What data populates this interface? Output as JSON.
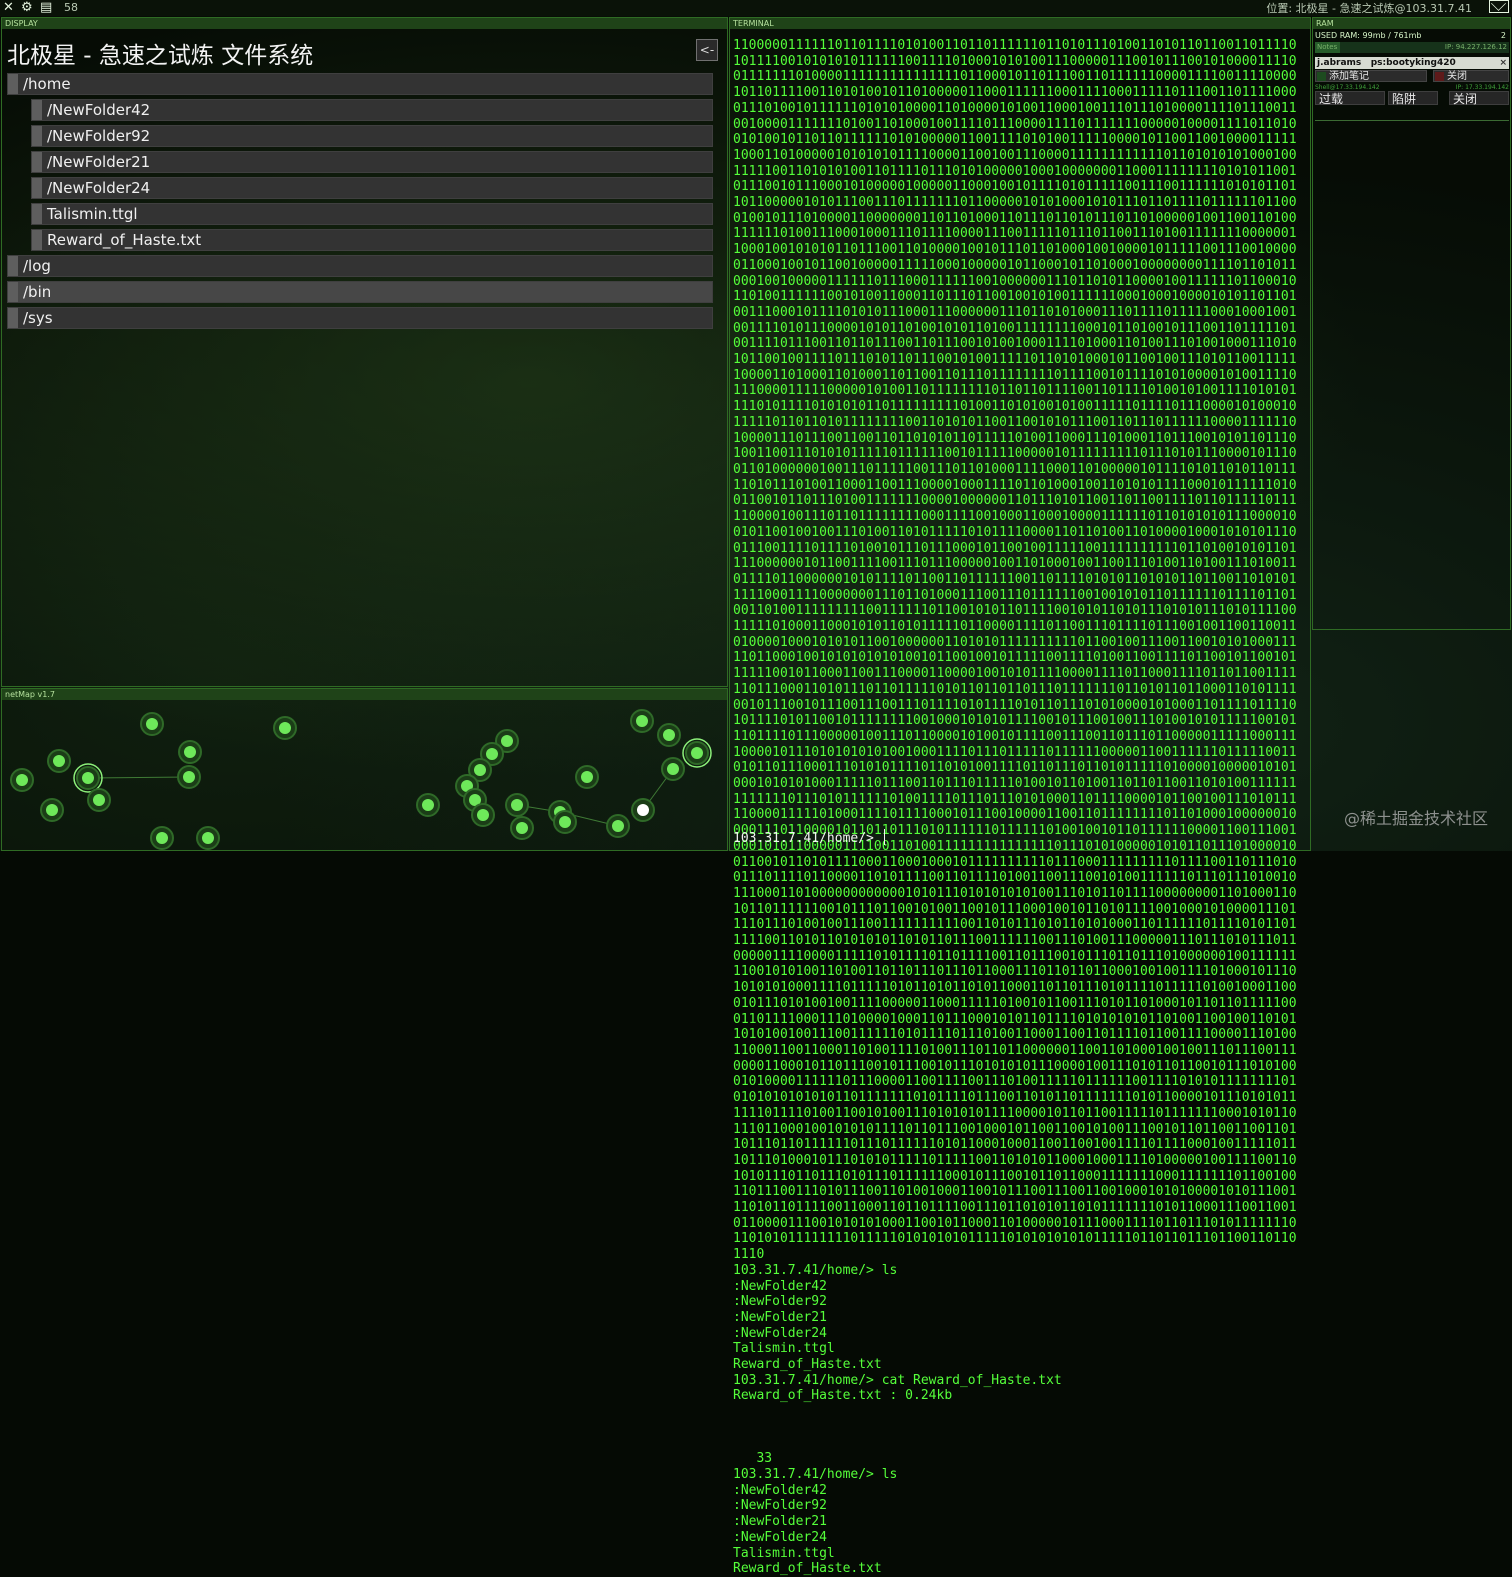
{
  "topbar": {
    "close_icon": "✕",
    "settings_icon": "⚙",
    "save_icon": "▤",
    "counter": "58",
    "location": "位置: 北极星 - 急速之试炼@103.31.7.41"
  },
  "display": {
    "header": "DISPLAY",
    "title": "北极星  -  急速之试炼 文件系统",
    "back_label": "<-",
    "items": [
      {
        "label": "/home"
      },
      {
        "label": "/NewFolder42"
      },
      {
        "label": "/NewFolder92"
      },
      {
        "label": "/NewFolder21"
      },
      {
        "label": "/NewFolder24"
      },
      {
        "label": "Talismin.ttgl"
      },
      {
        "label": "Reward_of_Haste.txt"
      },
      {
        "label": "/log"
      },
      {
        "label": "/bin"
      },
      {
        "label": "/sys"
      }
    ]
  },
  "netmap": {
    "header": "netMap v1.7",
    "node_color": "#6ee85a",
    "selected_color": "#ffffff"
  },
  "terminal": {
    "header": "TERMINAL",
    "text": "1100000111111011011110101001101101111110110101110100110101101100110111101011110010101010111111001111010001010100111000001110010111001010000111100111111101000011111111111111101100010110111001101111110000111100111100001011011110011010100101101000001100011111100011110001111101110011011110000111010010111111010101000011010000101001100010011101110100001111011100110010000111111101001101000100111101110000111101111111000001000011110110100101001011011011111101010000011001111010100111110000101100110010000111111000110100000101010101111000011001001110000111111111111011010101010001001111100110101010011011110111010100000100010000000110001111111101010110010111001011100010100000100000110001001011110101111100111001111110101011011011000001010111001110111111101100000101010001010111011011110111111011000100101110100001100000001101101000110111011010111011010000010011001101001111110100111000100011101111000011100111110111011001110100111111100000011000100101010110111001101000010010111011010001001000010111110011100100000110001001011001000001111100010000010110001011010001000000001111011010110001001000001111110111000111111001000000111011010110000100111111011000101101001111110010100110001101110110010010100111111000100010000101011011010011100010111101010111000111000000111011010100011101111011111000100010010011110101110000101011010010101101001111111100010110100101110011011111010011110111001101101110011011100101001000111101000110100111010010001110101011001001111011101011011100101001111101101010001011001001110101100111111000011010001101000110110011011101111111101111001011110101000010100111101110000111110000010100110111111110110110111100110111101001010011110101011110101111010101011011111111101001101010010100111110111101110000101000101111101101101011111111001101010110011001010111001101110111111000011111101000011101110011001101101010110111110100110001110100011011100101011011101001100111010101111101111110010111110000010111111111011101011100001011100110100000010011101111100111011010001111000110100000101111010110101101111101011101001100011001110000100011110110100010011010101111000101111110100110010110111010011111110000100000011011101011001101100111101101111101111100001001110110111111110001111001000110001000011111101101010101110000100101100100100111010011010111110101111000011011010011010000100010101011100111001111011110100101110111000101100100111110011111111110110100101011011110000001011001111001110111000001001101000100110011101001101001110100110111101100000010101111011001101111110011011110101011010101101100110101011111000111100000001110110100011100111011111100100101011011111101111011010011010011111111100111111011001010110111100101011010111010101110101111001111101000110001010110101111101100001111011001110111101110010011001100110100001000101010110010000001101010111111111101100100111001100101010001111101100010010101010101001011001001011111001111010011001111011001011001011111100101100011001110000110000100101011110000111101100011110110110011111101110001101011101101111101011011011011101111111011010110110001101011110010111001011100111001110111101011110101101110101000010100011011110111101011110101100101111111100100010101011110010111001001110100101011111001011101111011100000100111011000010100101111001110011011101100000111110001111000010111010101010100100011110111011111011111100000110011111101111100110101101110001110101011110110101001111011011101101011111010000100000101010001010101000111110111001101110111110100101101001101101100110101001111111111111011101011111101001111011101110101000110111100001011001001110101111100001111101000111101111000101110010000110011011111111011010001000000100001110110000101101101110101111110111111010010010110111111000011001110010001010110000011110011010011111111111111101110101000001010110111010000100110010110101111000110001000101111111111011100011111111101111001101110100111011110110000110101111001101111010011001110010100111111011101110100101110001101000000000000101011101010101010011101011011110000000011010001101011011111100101110110010100110010111000100101101011110010001010000111011110111010010011100111111111100110101110101101010001101111110111101011011111001101011010101011010110111001111110011101001110000011101110101110110000011110000111110101111011011110011011100101110110111010000001001111111100101010011010011011011101110110001110110110110001001001111010001011101010101000111101111101011010110101100011011011101011110111110100100011000101110101001001111000001100011111010010110011101011010001011011011111000110111100011101000010001101110001010110111101010101011010011001001101011010100100111001111110101111011101001100011001101111011001111000011101001100011001100011010011110100111011011000000110011010001001001110111001110000110001011011100101110010111010101011100001001110101101100101110101000101000011111101110000110011110011101001111101111110011110101011111111010101010101010110111111101011110111001101011011111110101100001011101010111111011110100110010100111010101011110000101101100111110111111100010101101110110001001010101111011011100100010110011001010011100101101100110011011011101101111110111011111101011000100011001100100111101111000100111110111011101000101110101011111011111001101010110001000111101000001001111001101010111011011101011101111110001011100101101100011111110001111111011001001101110011101011100110100100011001011100111001100100010101000010101110011101011011110011000110110111100111011010101101011111110101100011100110010110000111001010101000110010110001101000001011100011110110111010111111101101010111111110111110101010101111101010101010111110110110111011001101101110",
    "output_lines": [
      "103.31.7.41/home/> ls",
      ":NewFolder42",
      ":NewFolder92",
      ":NewFolder21",
      ":NewFolder24",
      "Talismin.ttgl",
      "Reward_of_Haste.txt",
      "103.31.7.41/home/> cat Reward_of_Haste.txt",
      "Reward_of_Haste.txt : 0.24kb",
      "",
      "",
      "",
      "   33",
      "103.31.7.41/home/> ls",
      ":NewFolder42",
      ":NewFolder92",
      ":NewFolder21",
      ":NewFolder24",
      "Talismin.ttgl",
      "Reward_of_Haste.txt"
    ],
    "prompt": "103.31.7.41/home/> "
  },
  "ram": {
    "header": "RAM",
    "used": "USED RAM: 99mb / 761mb",
    "count": "2",
    "used_fraction": 0.13,
    "bar_key": "Notes",
    "bar_ip": "IP: 94.227.126.12",
    "note_user": "j.abrams",
    "note_ps": "ps:bootyking420",
    "note_close_x": "×",
    "add_note": "添加笔记",
    "close": "关闭",
    "shell_label": "Shell@17.33.194.142",
    "shell_ip": "IP: 17.33.194.142",
    "overload": "过载",
    "trap": "陷阱",
    "close2": "关闭"
  },
  "watermark": "@稀土掘金技术社区"
}
